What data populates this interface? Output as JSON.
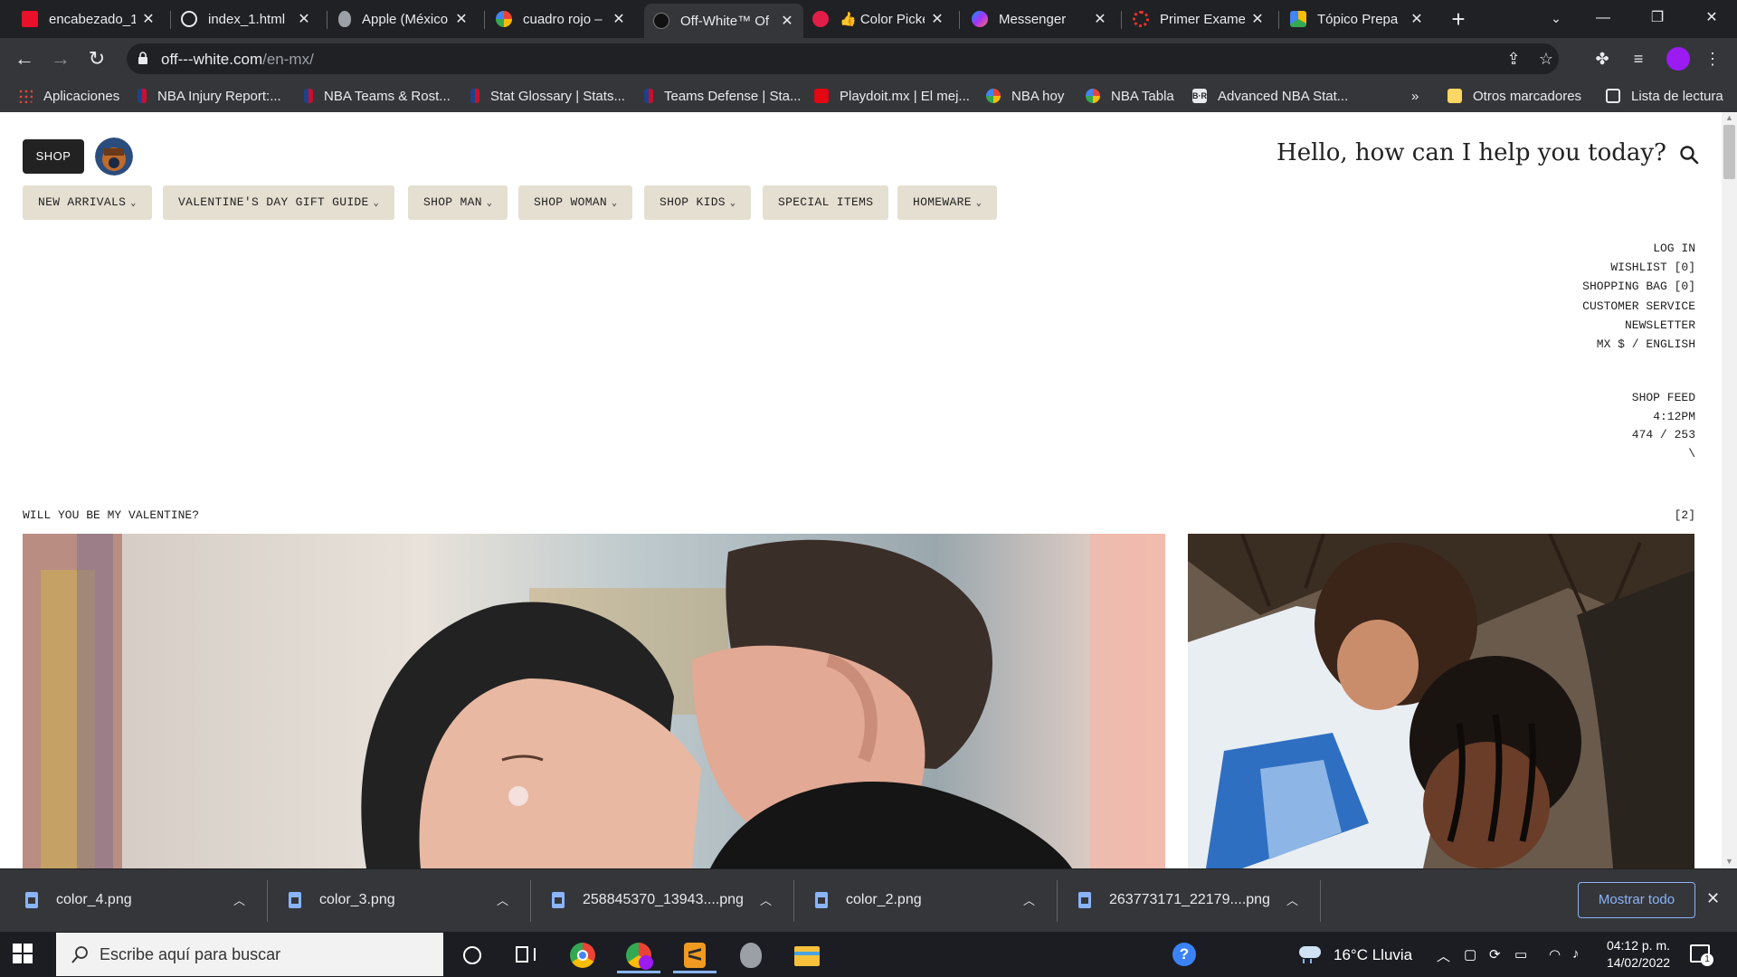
{
  "browser": {
    "tabs": [
      {
        "title": "encabezado_1",
        "icon": "red-square-icon",
        "active": false
      },
      {
        "title": "index_1.html",
        "icon": "globe-icon",
        "active": false
      },
      {
        "title": "Apple (México",
        "icon": "apple-icon",
        "active": false
      },
      {
        "title": "cuadro rojo – I",
        "icon": "google-icon",
        "active": false
      },
      {
        "title": "Off-White™ Of",
        "icon": "off-white-icon",
        "active": true
      },
      {
        "title": "👍 Color Picke",
        "icon": "color-picker-icon",
        "active": false
      },
      {
        "title": "Messenger",
        "icon": "messenger-icon",
        "active": false
      },
      {
        "title": "Primer Exame",
        "icon": "exam-icon",
        "active": false
      },
      {
        "title": "Tópico Prepa",
        "icon": "drive-icon",
        "active": false
      }
    ],
    "url_host": "off---white.com",
    "url_path": "/en-mx/",
    "bookmarks": [
      {
        "label": "Aplicaciones",
        "icon": "apps-grid-icon"
      },
      {
        "label": "NBA Injury Report:...",
        "icon": "nba-icon"
      },
      {
        "label": "NBA Teams & Rost...",
        "icon": "nba-icon"
      },
      {
        "label": "Stat Glossary | Stats...",
        "icon": "nba-icon"
      },
      {
        "label": "Teams Defense | Sta...",
        "icon": "nba-icon"
      },
      {
        "label": "Playdoit.mx | El mej...",
        "icon": "playdoit-icon"
      },
      {
        "label": "NBA hoy",
        "icon": "google-icon"
      },
      {
        "label": "NBA Tabla",
        "icon": "google-icon"
      },
      {
        "label": "Advanced NBA Stat...",
        "icon": "br-icon"
      }
    ],
    "bookmarks_overflow": "»",
    "other_bookmarks": "Otros marcadores",
    "reading_list": "Lista de lectura"
  },
  "page": {
    "shop_label": "SHOP",
    "greeting": "Hello, how can I help you today?",
    "menu": [
      {
        "label": "NEW ARRIVALS",
        "dropdown": true
      },
      {
        "label": "VALENTINE'S DAY GIFT GUIDE",
        "dropdown": true
      },
      {
        "label": "SHOP MAN",
        "dropdown": true
      },
      {
        "label": "SHOP WOMAN",
        "dropdown": true
      },
      {
        "label": "SHOP KIDS",
        "dropdown": true
      },
      {
        "label": "SPECIAL ITEMS",
        "dropdown": false
      },
      {
        "label": "HOMEWARE",
        "dropdown": true
      }
    ],
    "account_links": [
      "LOG IN",
      "WISHLIST [0]",
      "SHOPPING BAG [0]",
      "CUSTOMER SERVICE",
      "NEWSLETTER",
      "MX $ / ENGLISH"
    ],
    "feed": {
      "title": "SHOP FEED",
      "time": "4:12PM",
      "coords": "474 / 253",
      "slash": "\\"
    },
    "section_title": "WILL YOU BE MY VALENTINE?",
    "section_count": "[2]"
  },
  "downloads": {
    "files": [
      "color_4.png",
      "color_3.png",
      "258845370_13943....png",
      "color_2.png",
      "263773171_22179....png"
    ],
    "show_all": "Mostrar todo"
  },
  "taskbar": {
    "search_placeholder": "Escribe aquí para buscar",
    "weather": "16°C  Lluvia",
    "time": "04:12 p. m.",
    "date": "14/02/2022",
    "notifications": "1"
  },
  "colors": {
    "menu_bg": "#e5dfd2",
    "profile": "#9b1bf2",
    "link_blue": "#8ab4f8"
  }
}
